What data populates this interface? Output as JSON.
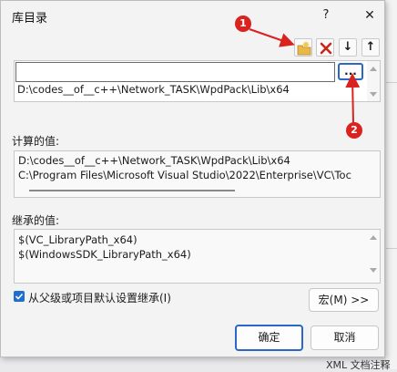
{
  "dialog": {
    "title": "库目录",
    "help_glyph": "?",
    "close_glyph": "✕"
  },
  "toolbar": {
    "new_folder_icon": "folder-new-icon",
    "delete_icon": "delete-red-x-icon",
    "move_down_glyph": "↓",
    "move_up_glyph": "↑"
  },
  "entries": {
    "edit_value": "",
    "items": [
      "D:\\codes__of__c++\\Network_TASK\\WpdPack\\Lib\\x64"
    ],
    "browse_label": "..."
  },
  "computed": {
    "label": "计算的值:",
    "values": [
      "D:\\codes__of__c++\\Network_TASK\\WpdPack\\Lib\\x64",
      "C:\\Program Files\\Microsoft Visual Studio\\2022\\Enterprise\\VC\\Toc"
    ]
  },
  "inherited": {
    "label": "继承的值:",
    "values": [
      "$(VC_LibraryPath_x64)",
      "$(WindowsSDK_LibraryPath_x64)"
    ]
  },
  "inherit_checkbox": {
    "label": "从父级或项目默认设置继承(I)",
    "checked": true
  },
  "buttons": {
    "macro": "宏(M) >>",
    "ok": "确定",
    "cancel": "取消"
  },
  "annotations": [
    "1",
    "2"
  ],
  "background": {
    "side_letter": "a",
    "footer_text": "XML 文档注释"
  },
  "colors": {
    "accent": "#2a67c6",
    "annotation_red": "#d9231e",
    "checkbox_blue": "#1f6fd1"
  }
}
